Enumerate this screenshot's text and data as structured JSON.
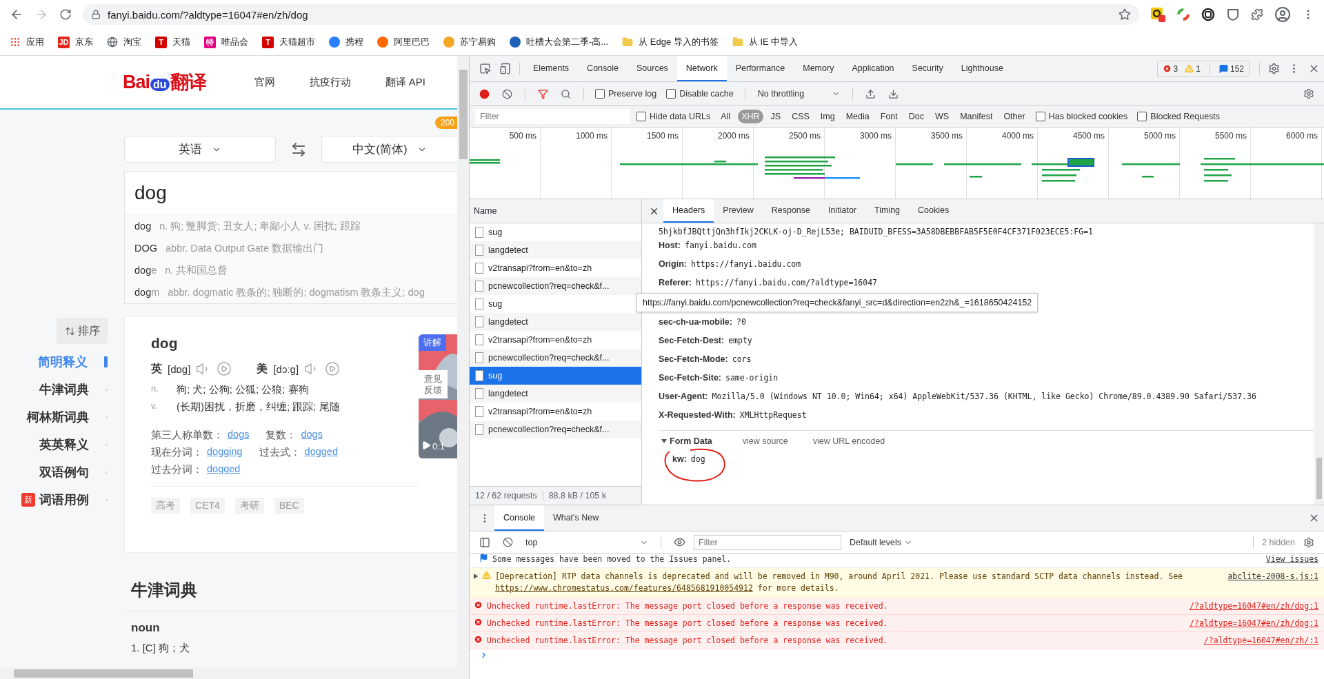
{
  "browser": {
    "url": "fanyi.baidu.com/?aldtype=16047#en/zh/dog",
    "bookmarks": [
      {
        "kind": "apps",
        "label": "应用"
      },
      {
        "kind": "badge",
        "glyph": "JD",
        "color": "#e1251b",
        "label": "京东"
      },
      {
        "kind": "globe",
        "label": "淘宝"
      },
      {
        "kind": "badge",
        "glyph": "T",
        "color": "#d00000",
        "label": "天猫"
      },
      {
        "kind": "badge",
        "glyph": "特",
        "color": "#e5007f",
        "label": "唯品会"
      },
      {
        "kind": "badge",
        "glyph": "T",
        "color": "#d00000",
        "label": "天猫超市"
      },
      {
        "kind": "logo",
        "color": "#2a7fff",
        "label": "携程"
      },
      {
        "kind": "logo",
        "color": "#ff6a00",
        "label": "阿里巴巴"
      },
      {
        "kind": "logo",
        "color": "#f5a623",
        "label": "苏宁易购"
      },
      {
        "kind": "logo",
        "color": "#1e5fb8",
        "label": "吐槽大会第二季-高..."
      },
      {
        "kind": "folder",
        "label": "从 Edge 导入的书签"
      },
      {
        "kind": "folder",
        "label": "从 IE 中导入"
      }
    ]
  },
  "site": {
    "logo": [
      "Bai",
      "du",
      "翻译"
    ],
    "nav": [
      "官网",
      "抗疫行动",
      "翻译 API"
    ],
    "badge": "200",
    "source_lang": "英语",
    "target_lang": "中文(简体)",
    "input": "dog",
    "suggestions": [
      {
        "match": "dog",
        "definition": "n. 狗; 蹩脚货; 丑女人; 卑鄙小人 v. 困扰; 跟踪"
      },
      {
        "match": "DOG",
        "definition": "abbr. Data Output Gate 数据输出门"
      },
      {
        "match": "dog",
        "rest": "e",
        "definition": "n. 共和国总督"
      },
      {
        "match": "dog",
        "rest": "m",
        "definition": "abbr. dogmatic 教条的; 独断的; dogmatism 教条主义; dog"
      }
    ],
    "sort": "排序",
    "sidebar": [
      {
        "label": "简明释义",
        "selected": true,
        "new": false
      },
      {
        "label": "牛津词典",
        "selected": false,
        "new": false
      },
      {
        "label": "柯林斯词典",
        "selected": false,
        "new": false
      },
      {
        "label": "英英释义",
        "selected": false,
        "new": false
      },
      {
        "label": "双语例句",
        "selected": false,
        "new": false
      },
      {
        "label": "词语用例",
        "selected": false,
        "new": true,
        "new_label": "新"
      }
    ],
    "entry": {
      "word": "dog",
      "pronunciations": [
        {
          "lang": "英",
          "ipa": "[dɒg]"
        },
        {
          "lang": "美",
          "ipa": "[dɔːg]"
        }
      ],
      "definitions": [
        {
          "pos": "n.",
          "text": "狗;  犬;  公狗;  公狐;  公狼;  赛狗"
        },
        {
          "pos": "v.",
          "text": "(长期)困扰，折磨，纠缠;  跟踪;  尾随"
        }
      ],
      "forms": [
        [
          {
            "label": "第三人称单数：",
            "value": "dogs"
          },
          {
            "label": "复数：",
            "value": "dogs"
          }
        ],
        [
          {
            "label": "现在分词：",
            "value": "dogging"
          },
          {
            "label": "过去式：",
            "value": "dogged"
          }
        ],
        [
          {
            "label": "过去分词：",
            "value": "dogged"
          }
        ]
      ],
      "tags": [
        "高考",
        "CET4",
        "考研",
        "BEC"
      ],
      "video": {
        "label": "讲解",
        "feedback": "意见反馈",
        "time": "0:1"
      }
    },
    "section": {
      "title": "牛津词典",
      "pos": "noun",
      "first": "1. [C] 狗；犬"
    }
  },
  "devtools": {
    "tabs": [
      {
        "label": "Elements",
        "selected": false
      },
      {
        "label": "Console",
        "selected": false
      },
      {
        "label": "Sources",
        "selected": false
      },
      {
        "label": "Network",
        "selected": true
      },
      {
        "label": "Performance",
        "selected": false
      },
      {
        "label": "Memory",
        "selected": false
      },
      {
        "label": "Application",
        "selected": false
      },
      {
        "label": "Security",
        "selected": false
      },
      {
        "label": "Lighthouse",
        "selected": false
      }
    ],
    "counts": {
      "errors": "3",
      "warnings": "1",
      "messages": "152"
    },
    "recording": true,
    "filter_active": true,
    "preserve_log": {
      "label": "Preserve log",
      "checked": false
    },
    "disable_cache": {
      "label": "Disable cache",
      "checked": false
    },
    "throttling": "No throttling",
    "filter": {
      "placeholder": "Filter"
    },
    "hide_data_urls": {
      "label": "Hide data URLs",
      "checked": false
    },
    "types": [
      {
        "label": "All",
        "selected": false
      },
      {
        "label": "XHR",
        "selected": true
      },
      {
        "label": "JS",
        "selected": false
      },
      {
        "label": "CSS",
        "selected": false
      },
      {
        "label": "Img",
        "selected": false
      },
      {
        "label": "Media",
        "selected": false
      },
      {
        "label": "Font",
        "selected": false
      },
      {
        "label": "Doc",
        "selected": false
      },
      {
        "label": "WS",
        "selected": false
      },
      {
        "label": "Manifest",
        "selected": false
      },
      {
        "label": "Other",
        "selected": false
      }
    ],
    "has_blocked_cookies": {
      "label": "Has blocked cookies",
      "checked": false
    },
    "blocked_requests": {
      "label": "Blocked Requests",
      "checked": false
    },
    "overview_ticks": [
      "500 ms",
      "1000 ms",
      "1500 ms",
      "2000 ms",
      "2500 ms",
      "3000 ms",
      "3500 ms",
      "4000 ms",
      "4500 ms",
      "5000 ms",
      "5500 ms",
      "6000 ms"
    ],
    "requests": {
      "column": "Name",
      "rows": [
        {
          "name": "sug",
          "selected": false
        },
        {
          "name": "langdetect",
          "selected": false
        },
        {
          "name": "v2transapi?from=en&to=zh",
          "selected": false
        },
        {
          "name": "pcnewcollection?req=check&f...",
          "selected": false
        },
        {
          "name": "sug",
          "selected": false
        },
        {
          "name": "langdetect",
          "selected": false
        },
        {
          "name": "v2transapi?from=en&to=zh",
          "selected": false
        },
        {
          "name": "pcnewcollection?req=check&f...",
          "selected": false
        },
        {
          "name": "sug",
          "selected": true
        },
        {
          "name": "langdetect",
          "selected": false
        },
        {
          "name": "v2transapi?from=en&to=zh",
          "selected": false
        },
        {
          "name": "pcnewcollection?req=check&f...",
          "selected": false
        }
      ],
      "status": [
        "12 / 62 requests",
        "88.8 kB / 105 k"
      ]
    },
    "detail_tabs": [
      {
        "label": "Headers",
        "selected": true
      },
      {
        "label": "Preview",
        "selected": false
      },
      {
        "label": "Response",
        "selected": false
      },
      {
        "label": "Initiator",
        "selected": false
      },
      {
        "label": "Timing",
        "selected": false
      },
      {
        "label": "Cookies",
        "selected": false
      }
    ],
    "cookie_tail": "5hjkbfJBQttjQn3hfIkj2CKLK-oj-D_RejL53e; BAIDUID_BFESS=3A58DBEBBFAB5F5E0F4CF371F023ECE5:FG=1",
    "headers": [
      {
        "name": "Host:",
        "value": "fanyi.baidu.com"
      },
      {
        "name": "Origin:",
        "value": "https://fanyi.baidu.com"
      },
      {
        "name": "Referer:",
        "value": "https://fanyi.baidu.com/?aldtype=16047"
      },
      {
        "name": "sec-ch-ua-mobile:",
        "value": "?0"
      },
      {
        "name": "Sec-Fetch-Dest:",
        "value": "empty"
      },
      {
        "name": "Sec-Fetch-Mode:",
        "value": "cors"
      },
      {
        "name": "Sec-Fetch-Site:",
        "value": "same-origin"
      },
      {
        "name": "User-Agent:",
        "value": "Mozilla/5.0 (Windows NT 10.0; Win64; x64) AppleWebKit/537.36 (KHTML, like Gecko) Chrome/89.0.4389.90 Safari/537.36"
      },
      {
        "name": "X-Requested-With:",
        "value": "XMLHttpRequest"
      }
    ],
    "tooltip": "https://fanyi.baidu.com/pcnewcollection?req=check&fanyi_src=d&direction=en2zh&_=1618650424152",
    "form_data": {
      "title": "Form Data",
      "expanded": true,
      "links": [
        "view source",
        "view URL encoded"
      ],
      "fields": [
        {
          "name": "kw:",
          "value": "dog"
        }
      ]
    },
    "drawer": {
      "tabs": [
        {
          "label": "Console",
          "selected": true
        },
        {
          "label": "What's New",
          "selected": false
        }
      ],
      "context": "top",
      "filter": {
        "placeholder": "Filter"
      },
      "levels": "Default levels",
      "hidden": "2 hidden",
      "messages": [
        {
          "kind": "info",
          "text": "Some messages have been moved to the Issues panel.",
          "source": "View issues"
        },
        {
          "kind": "warning",
          "text": "[Deprecation] RTP data channels is deprecated and will be removed in M90, around April 2021. Please use standard SCTP data channels instead. See ",
          "link": "https://www.chromestatus.com/features/6485681910054912",
          "text_after": " for more details.",
          "source": "abclite-2008-s.js:1"
        },
        {
          "kind": "error",
          "text": "Unchecked runtime.lastError: The message port closed before a response was received.",
          "source": "/?aldtype=16047#en/zh/dog:1"
        },
        {
          "kind": "error",
          "text": "Unchecked runtime.lastError: The message port closed before a response was received.",
          "source": "/?aldtype=16047#en/zh/dog:1"
        },
        {
          "kind": "error",
          "text": "Unchecked runtime.lastError: The message port closed before a response was received.",
          "source": "/?aldtype=16047#en/zh/:1"
        }
      ]
    }
  }
}
